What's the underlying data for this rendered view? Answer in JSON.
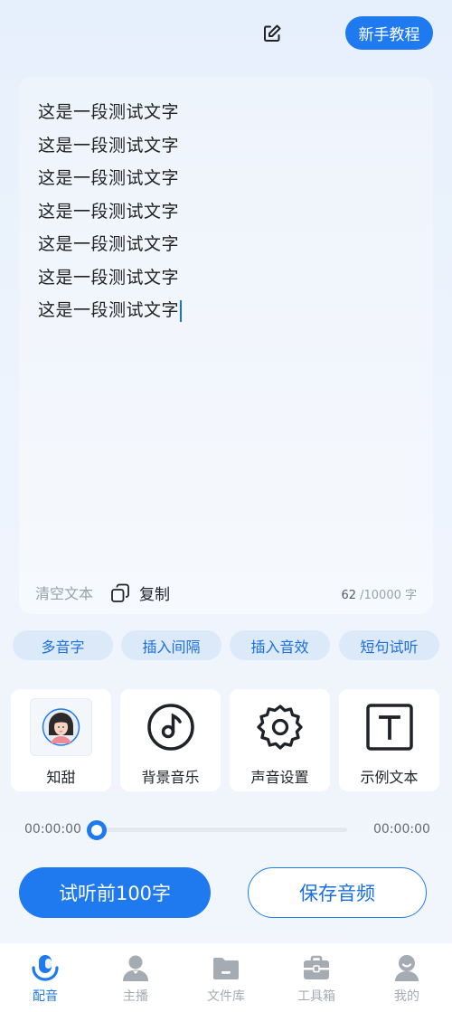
{
  "header": {
    "edit_icon": "edit-icon",
    "tutorial_label": "新手教程"
  },
  "editor": {
    "lines": [
      "这是一段测试文字",
      "这是一段测试文字",
      "这是一段测试文字",
      "这是一段测试文字",
      "这是一段测试文字",
      "这是一段测试文字",
      "这是一段测试文字"
    ],
    "clear_label": "清空文本",
    "copy_label": "复制",
    "count_current": "62",
    "count_max": "/10000 字"
  },
  "chips": [
    "多音字",
    "插入间隔",
    "插入音效",
    "短句试听"
  ],
  "tools": {
    "voice_label": "知甜",
    "bgm_label": "背景音乐",
    "sound_settings_label": "声音设置",
    "sample_text_label": "示例文本"
  },
  "player": {
    "time_current": "00:00:00",
    "time_total": "00:00:00",
    "progress": 0
  },
  "actions": {
    "preview_label": "试听前100字",
    "save_label": "保存音频"
  },
  "tabs": [
    {
      "label": "配音",
      "icon": "mic-icon",
      "active": true
    },
    {
      "label": "主播",
      "icon": "person-icon",
      "active": false
    },
    {
      "label": "文件库",
      "icon": "folder-icon",
      "active": false
    },
    {
      "label": "工具箱",
      "icon": "toolbox-icon",
      "active": false
    },
    {
      "label": "我的",
      "icon": "profile-icon",
      "active": false
    }
  ],
  "colors": {
    "accent": "#1f7af0",
    "chip_bg": "#dce9f9",
    "tab_inactive": "#a5abb3"
  }
}
